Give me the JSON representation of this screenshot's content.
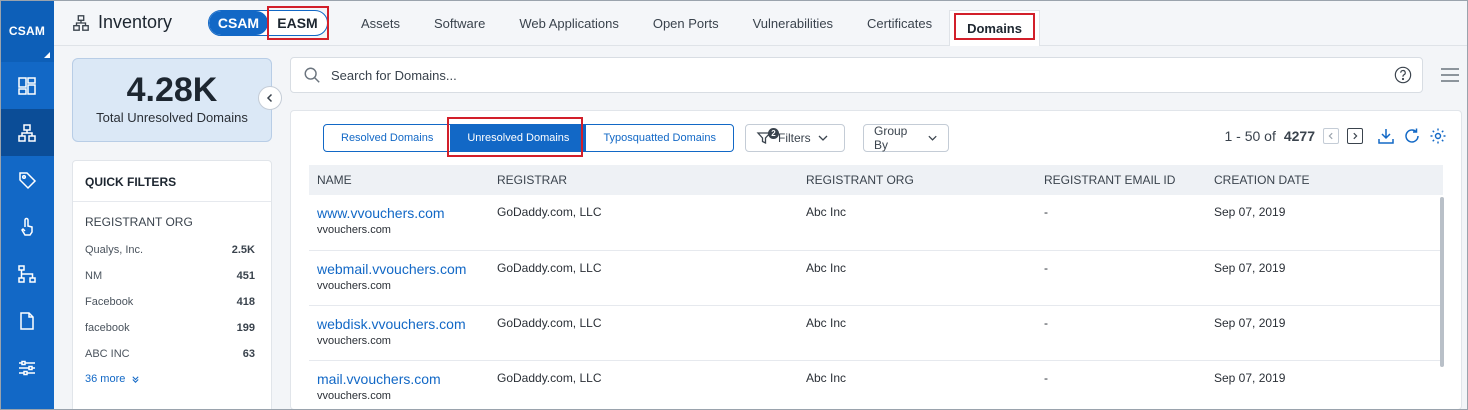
{
  "brand": "CSAM",
  "header": {
    "title": "Inventory",
    "toggle": [
      "CSAM",
      "EASM"
    ],
    "tabs": [
      "Assets",
      "Software",
      "Web Applications",
      "Open Ports",
      "Vulnerabilities",
      "Certificates",
      "Domains"
    ],
    "active_tab": "Domains"
  },
  "summary": {
    "value": "4.28K",
    "label": "Total Unresolved Domains"
  },
  "quick_filters": {
    "title": "QUICK FILTERS",
    "group": "REGISTRANT ORG",
    "items": [
      {
        "label": "Qualys, Inc.",
        "count": "2.5K"
      },
      {
        "label": "NM",
        "count": "451"
      },
      {
        "label": "Facebook",
        "count": "418"
      },
      {
        "label": "facebook",
        "count": "199"
      },
      {
        "label": "ABC INC",
        "count": "63"
      }
    ],
    "more": "36 more"
  },
  "search": {
    "placeholder": "Search for Domains..."
  },
  "segments": [
    "Resolved Domains",
    "Unresolved Domains",
    "Typosquatted Domains"
  ],
  "filters": {
    "label": "Filters",
    "badge": "2"
  },
  "group_by": "Group By",
  "pager": {
    "range": "1 - 50 of",
    "total": "4277"
  },
  "table": {
    "columns": [
      "Name",
      "Registrar",
      "Registrant Org",
      "Registrant Email ID",
      "Creation Date"
    ],
    "rows": [
      {
        "name": "www.vvouchers.com",
        "sub": "vvouchers.com",
        "registrar": "GoDaddy.com, LLC",
        "org": "Abc Inc",
        "email": "-",
        "date": "Sep 07, 2019"
      },
      {
        "name": "webmail.vvouchers.com",
        "sub": "vvouchers.com",
        "registrar": "GoDaddy.com, LLC",
        "org": "Abc Inc",
        "email": "-",
        "date": "Sep 07, 2019"
      },
      {
        "name": "webdisk.vvouchers.com",
        "sub": "vvouchers.com",
        "registrar": "GoDaddy.com, LLC",
        "org": "Abc Inc",
        "email": "-",
        "date": "Sep 07, 2019"
      },
      {
        "name": "mail.vvouchers.com",
        "sub": "vvouchers.com",
        "registrar": "GoDaddy.com, LLC",
        "org": "Abc Inc",
        "email": "-",
        "date": "Sep 07, 2019"
      }
    ]
  },
  "colors": {
    "primary": "#1268c6",
    "highlight": "#d21f2a",
    "summary_bg": "#dbe8f6"
  }
}
